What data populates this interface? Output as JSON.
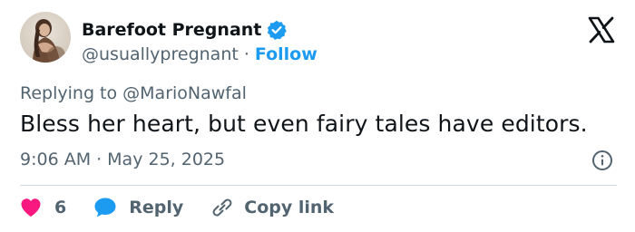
{
  "author": {
    "name": "Barefoot Pregnant",
    "handle": "@usuallypregnant",
    "separator": "·",
    "follow_label": "Follow",
    "verified": true,
    "avatar_icon": "avatar-photo"
  },
  "platform_icon": "x-logo-icon",
  "reply_context": {
    "text": "Replying to @MarioNawfal"
  },
  "tweet": {
    "text": "Bless her heart, but even fairy tales have editors."
  },
  "meta": {
    "time": "9:06 AM",
    "separator": "·",
    "date": "May 25, 2025",
    "info_icon": "info-icon"
  },
  "actions": {
    "like_count": "6",
    "reply_label": "Reply",
    "copy_label": "Copy link"
  },
  "colors": {
    "accent": "#1d9bf0",
    "like": "#f91880",
    "text": "#0f1419",
    "muted": "#536471",
    "divider": "#cfd9de"
  }
}
